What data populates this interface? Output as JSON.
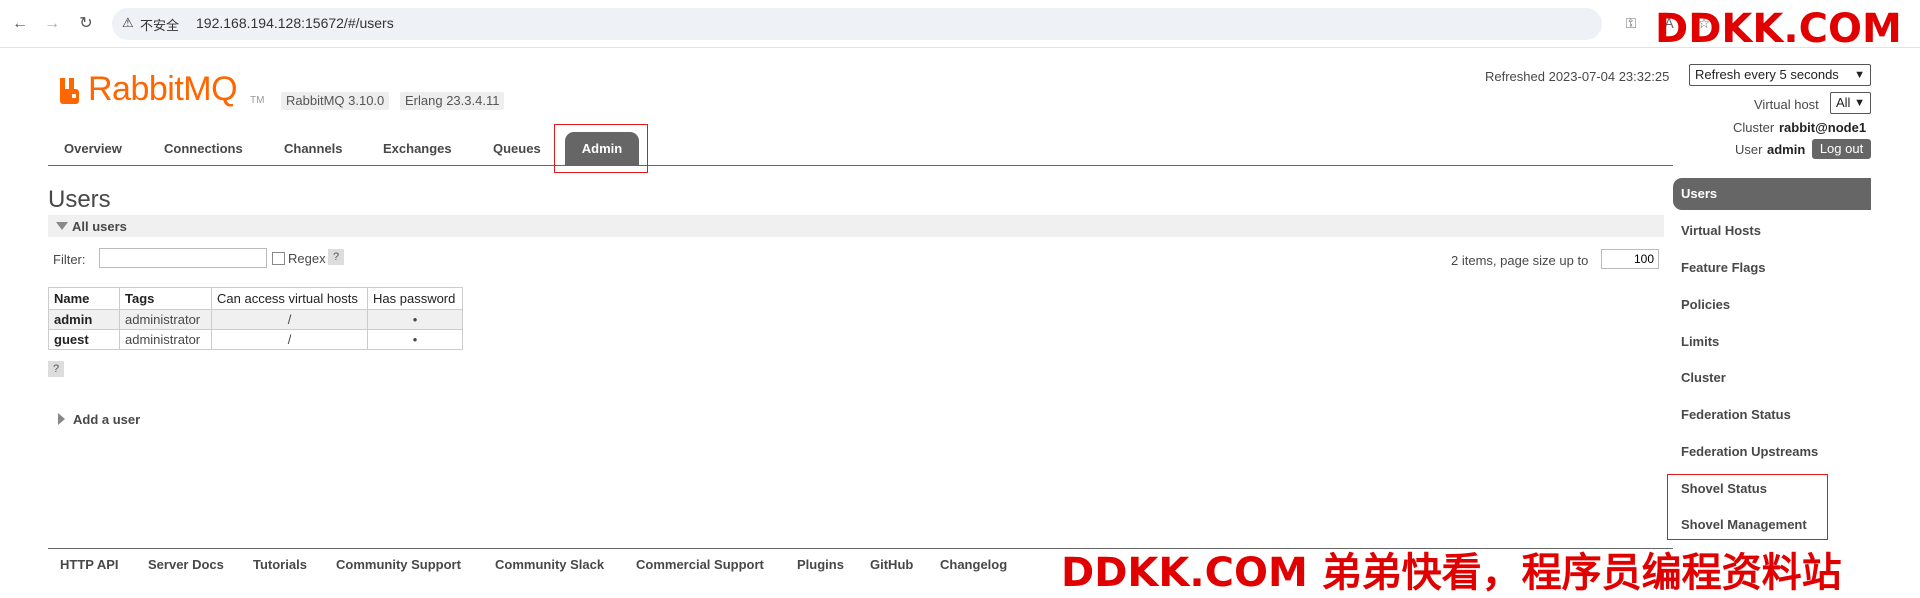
{
  "browser": {
    "insecure_label": "不安全",
    "url": "192.168.194.128:15672/#/users",
    "back_icon": "back-arrow-icon",
    "forward_icon": "forward-arrow-icon",
    "reload_icon": "reload-icon"
  },
  "watermark": {
    "top": "DDKK.COM",
    "bottom": "DDKK.COM 弟弟快看，程序员编程资料站"
  },
  "header": {
    "logo_text": "RabbitMQ",
    "logo_tm": "TM",
    "version_badge": "RabbitMQ 3.10.0",
    "erlang_badge": "Erlang 23.3.4.11"
  },
  "topright": {
    "refreshed": "Refreshed 2023-07-04 23:32:25",
    "refresh_select": "Refresh every 5 seconds",
    "vhost_label": "Virtual host",
    "vhost_select": "All",
    "cluster_label": "Cluster",
    "cluster_name": "rabbit@node1",
    "user_label": "User",
    "user_name": "admin",
    "logout": "Log out"
  },
  "tabs": [
    "Overview",
    "Connections",
    "Channels",
    "Exchanges",
    "Queues",
    "Admin"
  ],
  "active_tab": "Admin",
  "page": {
    "title": "Users",
    "section": "All users",
    "filter_label": "Filter:",
    "filter_value": "",
    "regex_label": "Regex",
    "help": "?",
    "paging_label": "2 items, page size up to",
    "page_size": "100",
    "add_user": "Add a user"
  },
  "table": {
    "headers": [
      "Name",
      "Tags",
      "Can access virtual hosts",
      "Has password"
    ],
    "rows": [
      {
        "name": "admin",
        "tags": "administrator",
        "vhosts": "/",
        "has_password": "•"
      },
      {
        "name": "guest",
        "tags": "administrator",
        "vhosts": "/",
        "has_password": "•"
      }
    ]
  },
  "sidebar": {
    "items": [
      "Users",
      "Virtual Hosts",
      "Feature Flags",
      "Policies",
      "Limits",
      "Cluster",
      "Federation Status",
      "Federation Upstreams",
      "Shovel Status",
      "Shovel Management"
    ],
    "active": "Users"
  },
  "footer": {
    "links": [
      "HTTP API",
      "Server Docs",
      "Tutorials",
      "Community Support",
      "Community Slack",
      "Commercial Support",
      "Plugins",
      "GitHub",
      "Changelog"
    ]
  },
  "colors": {
    "brand": "#ff6600",
    "tab_active": "#666666",
    "highlight_box": "#e01a1a",
    "watermark": "#e00000"
  }
}
